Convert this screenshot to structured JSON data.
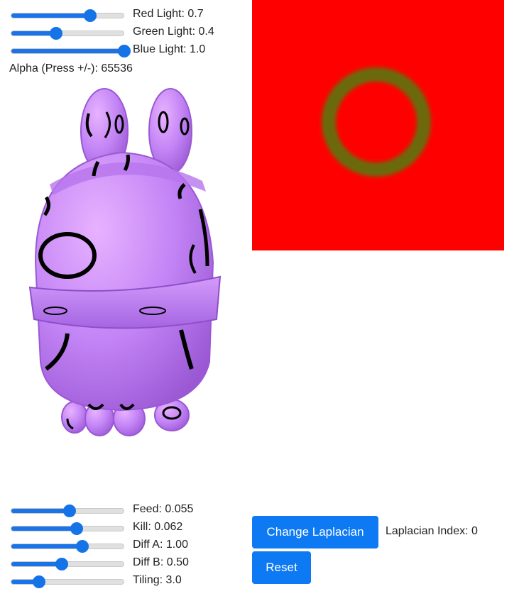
{
  "light_controls": [
    {
      "id": "red",
      "label": "Red Light: 0.7",
      "value": 0.7
    },
    {
      "id": "green",
      "label": "Green Light: 0.4",
      "value": 0.4
    },
    {
      "id": "blue",
      "label": "Blue Light: 1.0",
      "value": 1.0
    }
  ],
  "alpha_text": "Alpha (Press +/-): 65536",
  "sim_controls": [
    {
      "id": "feed",
      "label": "Feed: 0.055",
      "value": 0.52
    },
    {
      "id": "kill",
      "label": "Kill: 0.062",
      "value": 0.58
    },
    {
      "id": "diffa",
      "label": "Diff A: 1.00",
      "value": 0.63
    },
    {
      "id": "diffb",
      "label": "Diff B: 0.50",
      "value": 0.45
    },
    {
      "id": "tiling",
      "label": "Tiling: 3.0",
      "value": 0.25
    }
  ],
  "buttons": {
    "change_laplacian": "Change Laplacian",
    "reset": "Reset"
  },
  "laplacian_index_text": "Laplacian Index: 0",
  "texture_colors": {
    "background": "#ff0000",
    "ring": "#6b6b08"
  },
  "model_color": "#cc88ff"
}
